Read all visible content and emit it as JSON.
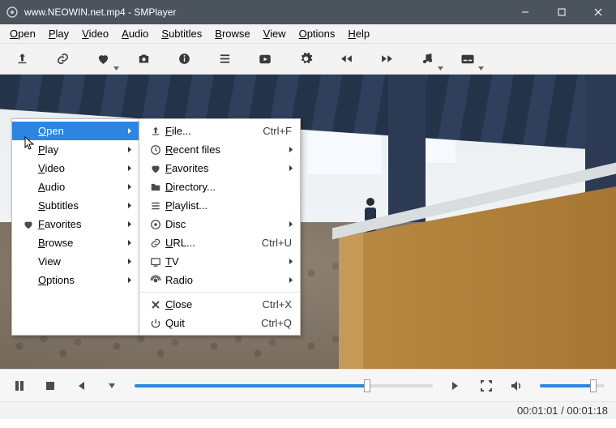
{
  "title": "www.NEOWIN.net.mp4 - SMPlayer",
  "menubar": [
    "Open",
    "Play",
    "Video",
    "Audio",
    "Subtitles",
    "Browse",
    "View",
    "Options",
    "Help"
  ],
  "toolbar_icons": [
    "open-file-icon",
    "open-url-icon",
    "favorites-icon",
    "screenshot-icon",
    "info-icon",
    "playlist-icon",
    "play-icon",
    "preferences-icon",
    "prev-icon",
    "next-icon",
    "audio-track-icon",
    "subtitles-icon"
  ],
  "context_menu": {
    "left": [
      {
        "label": "Open",
        "ul": "O",
        "arrow": true,
        "selected": true,
        "icon": ""
      },
      {
        "label": "Play",
        "ul": "P",
        "arrow": true,
        "icon": ""
      },
      {
        "label": "Video",
        "ul": "V",
        "arrow": true,
        "icon": ""
      },
      {
        "label": "Audio",
        "ul": "A",
        "arrow": true,
        "icon": ""
      },
      {
        "label": "Subtitles",
        "ul": "S",
        "arrow": true,
        "icon": ""
      },
      {
        "label": "Favorites",
        "ul": "F",
        "arrow": true,
        "icon": "heart"
      },
      {
        "label": "Browse",
        "ul": "B",
        "arrow": true,
        "icon": ""
      },
      {
        "label": "View",
        "ul": "",
        "arrow": true,
        "icon": ""
      },
      {
        "label": "Options",
        "ul": "O",
        "arrow": true,
        "icon": ""
      }
    ],
    "right": [
      {
        "label": "File...",
        "ul": "F",
        "icon": "file",
        "shortcut": "Ctrl+F"
      },
      {
        "label": "Recent files",
        "ul": "R",
        "icon": "clock",
        "arrow": true
      },
      {
        "label": "Favorites",
        "ul": "F",
        "icon": "heart",
        "arrow": true
      },
      {
        "label": "Directory...",
        "ul": "D",
        "icon": "folder"
      },
      {
        "label": "Playlist...",
        "ul": "P",
        "icon": "list"
      },
      {
        "label": "Disc",
        "ul": "",
        "icon": "disc",
        "arrow": true
      },
      {
        "label": "URL...",
        "ul": "U",
        "icon": "link",
        "shortcut": "Ctrl+U"
      },
      {
        "label": "TV",
        "ul": "T",
        "icon": "tv",
        "arrow": true
      },
      {
        "label": "Radio",
        "ul": "",
        "icon": "radio",
        "arrow": true
      },
      {
        "sep": true
      },
      {
        "label": "Close",
        "ul": "C",
        "icon": "close",
        "shortcut": "Ctrl+X"
      },
      {
        "label": "Quit",
        "ul": "",
        "icon": "power",
        "shortcut": "Ctrl+Q"
      }
    ]
  },
  "status": {
    "current": "00:01:01",
    "total": "00:01:18"
  },
  "seek_percent": 78,
  "volume_percent": 82
}
